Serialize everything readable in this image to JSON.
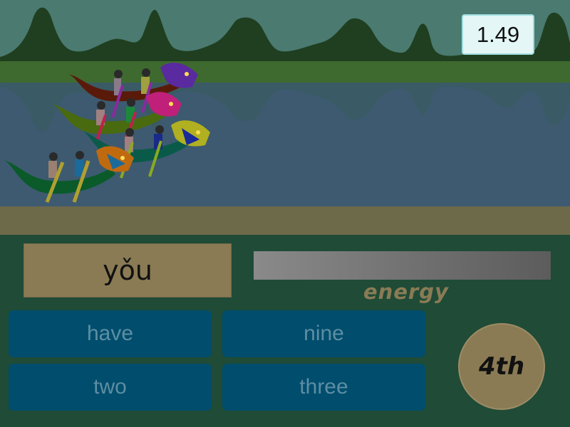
{
  "timer": {
    "value": "1.49"
  },
  "prompt": {
    "word": "yǒu"
  },
  "energy": {
    "label": "energy"
  },
  "answers": [
    {
      "label": "have"
    },
    {
      "label": "nine"
    },
    {
      "label": "two"
    },
    {
      "label": "three"
    }
  ],
  "race": {
    "position": "4th"
  },
  "boats": [
    {
      "hull": "#5a1a0a",
      "dragon": "#5a2aa0",
      "rowers": 2
    },
    {
      "hull": "#4a6a10",
      "dragon": "#c0207a",
      "rowers": 2
    },
    {
      "hull": "#0a5a4a",
      "dragon": "#b0b020",
      "rowers": 2
    },
    {
      "hull": "#0a5a2a",
      "dragon": "#c06a10",
      "rowers": 2
    }
  ],
  "colors": {
    "sky": "#4a7a70",
    "mountains": "#1f3f20",
    "bank": "#3f6a2f",
    "water": "#3d5a70",
    "sand": "#6d6a4a",
    "answer_bg": "#004d6d",
    "answer_text": "#5d8ea3",
    "card": "#8a7b55"
  }
}
